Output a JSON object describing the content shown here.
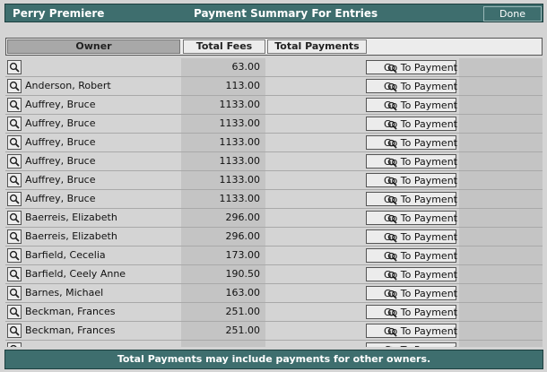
{
  "window": {
    "app_title": "Perry Premiere",
    "title": "Payment Summary For Entries",
    "done_label": "Done"
  },
  "columns": {
    "owner": "Owner",
    "total_fees": "Total Fees",
    "total_payments": "Total Payments"
  },
  "goto_label": "Go To Payment",
  "rows": [
    {
      "owner": "",
      "fees": "63.00"
    },
    {
      "owner": "Anderson, Robert",
      "fees": "113.00"
    },
    {
      "owner": "Auffrey, Bruce",
      "fees": "1133.00"
    },
    {
      "owner": "Auffrey, Bruce",
      "fees": "1133.00"
    },
    {
      "owner": "Auffrey, Bruce",
      "fees": "1133.00"
    },
    {
      "owner": "Auffrey, Bruce",
      "fees": "1133.00"
    },
    {
      "owner": "Auffrey, Bruce",
      "fees": "1133.00"
    },
    {
      "owner": "Auffrey, Bruce",
      "fees": "1133.00"
    },
    {
      "owner": "Baerreis, Elizabeth",
      "fees": "296.00"
    },
    {
      "owner": "Baerreis, Elizabeth",
      "fees": "296.00"
    },
    {
      "owner": "Barfield, Cecelia",
      "fees": "173.00"
    },
    {
      "owner": "Barfield, Ceely Anne",
      "fees": "190.50"
    },
    {
      "owner": "Barnes, Michael",
      "fees": "163.00"
    },
    {
      "owner": "Beckman, Frances",
      "fees": "251.00"
    },
    {
      "owner": "Beckman, Frances",
      "fees": "251.00"
    },
    {
      "owner": "",
      "fees": ""
    }
  ],
  "footer_note": "Total Payments may include payments for other owners.",
  "colors": {
    "titlebar": "#3e6e6e",
    "background": "#d4d4d4",
    "cell_shade": "#c4c4c4"
  },
  "icons": {
    "row_inspect": "magnifier-icon",
    "goto": "magnifier-icon"
  }
}
